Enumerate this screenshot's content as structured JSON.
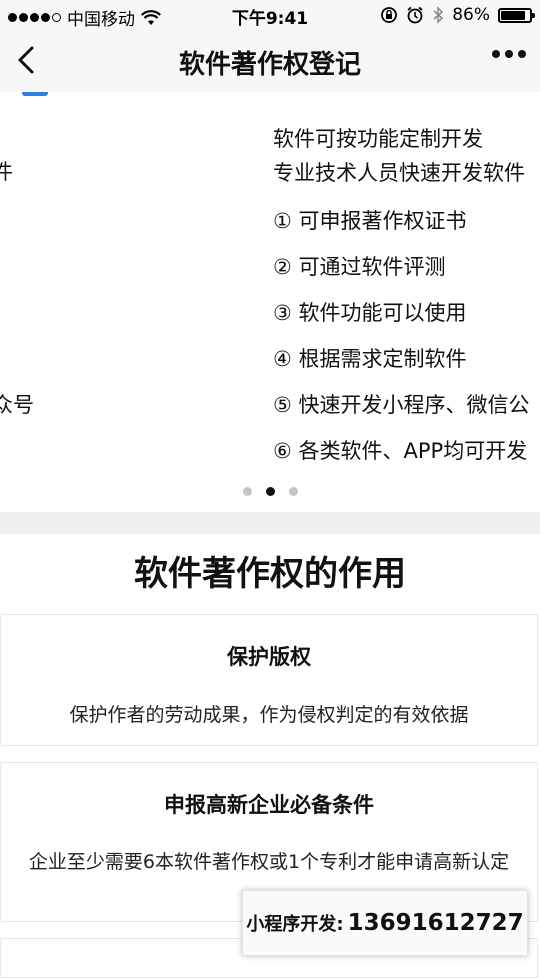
{
  "status_bar": {
    "carrier": "中国移动",
    "time": "下午9:41",
    "battery_percent": "86%",
    "battery_level": 0.86,
    "icons": [
      "signal-dots-icon",
      "wifi-icon",
      "rotation-lock-icon",
      "alarm-icon",
      "bluetooth-icon",
      "battery-icon"
    ]
  },
  "nav": {
    "title": "软件著作权登记",
    "back_icon": "chevron-left-icon",
    "more_icon": "more-dots-icon"
  },
  "banner": {
    "prev_slide_fragments": [
      "件",
      "众号"
    ],
    "slide": {
      "intro": [
        "软件可按功能定制开发",
        "专业技术人员快速开发软件"
      ],
      "items": [
        "① 可申报著作权证书",
        "② 可通过软件评测",
        "③ 软件功能可以使用",
        "④ 根据需求定制软件",
        "⑤ 快速开发小程序、微信公",
        "⑥ 各类软件、APP均可开发"
      ]
    },
    "pager": {
      "count": 3,
      "active_index": 1
    }
  },
  "section": {
    "title": "软件著作权的作用",
    "cards": [
      {
        "title": "保护版权",
        "desc": "保护作者的劳动成果，作为侵权判定的有效依据"
      },
      {
        "title": "申报高新企业必备条件",
        "desc": "企业至少需要6本软件著作权或1个专利才能申请高新认定"
      }
    ]
  },
  "floating_contact": {
    "label": "小程序开发:",
    "phone": "13691612727"
  }
}
